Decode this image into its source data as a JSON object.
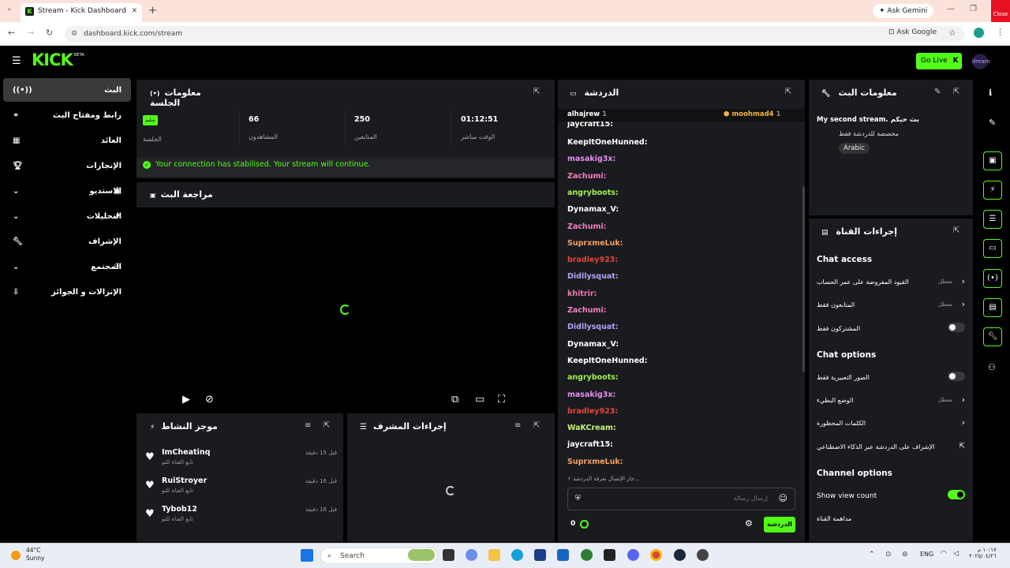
{
  "browser": {
    "tab_title": "Stream - Kick Dashboard",
    "url": "dashboard.kick.com/stream",
    "ask_gemini": "Ask Gemini",
    "ask_google": "Ask Google",
    "close_tooltip": "Close"
  },
  "header": {
    "logo": "KICK",
    "beta": "BETA",
    "go_live": "Go Live",
    "avatar_text": "dream"
  },
  "sidebar": {
    "items": [
      {
        "label": "البث"
      },
      {
        "label": "رابط ومفتاح البث"
      },
      {
        "label": "العائد"
      },
      {
        "label": "الإنجازات"
      },
      {
        "label": "الاستديو"
      },
      {
        "label": "التحليلات"
      },
      {
        "label": "الإشراف"
      },
      {
        "label": "المجتمع"
      },
      {
        "label": "الإنزالات و الجوائز"
      }
    ]
  },
  "session": {
    "title": "معلومات الجلسة",
    "badge": "سليم",
    "badge_label": "الجلسة",
    "stats": [
      {
        "value": "66",
        "label": "المشاهدون"
      },
      {
        "value": "250",
        "label": "المتابعين"
      },
      {
        "value": "01:12:51",
        "label": "الوقت مباشر"
      }
    ],
    "banner": "Your connection has stabilised. Your stream will continue."
  },
  "review": {
    "title": "مراجعة البث"
  },
  "activity": {
    "title": "موجز النشاط",
    "items": [
      {
        "name": "ImCheatinq",
        "sub": "تابع القناة للتو",
        "time": "قبل 15 دقيقة"
      },
      {
        "name": "RuiStroyer",
        "sub": "تابع القناة للتو",
        "time": "قبل 16 دقيقة"
      },
      {
        "name": "Tybob12",
        "sub": "تابع القناة للتو",
        "time": "قبل 16 دقيقة"
      }
    ]
  },
  "mod_actions": {
    "title": "إجراءات المشرف"
  },
  "chat": {
    "title": "الدردشة",
    "pinned_left": "alhajrew",
    "pinned_left_count": "1",
    "pinned_right": "moohmad4",
    "pinned_right_count": "1",
    "messages": [
      {
        "user": "jaycraft15:",
        "color": "#ffffff"
      },
      {
        "user": "KeepItOneHunned:",
        "color": "#ffffff"
      },
      {
        "user": "masakig3x:",
        "color": "#e88ef0"
      },
      {
        "user": "Zachumi:",
        "color": "#f580c0"
      },
      {
        "user": "angryboots:",
        "color": "#a3f050"
      },
      {
        "user": "Dynamax_V:",
        "color": "#ffffff"
      },
      {
        "user": "Zachumi:",
        "color": "#f580c0"
      },
      {
        "user": "SuprxmeLuk:",
        "color": "#f7a060"
      },
      {
        "user": "bradley923:",
        "color": "#e2443c"
      },
      {
        "user": "Didllysquat:",
        "color": "#b0a4f5"
      },
      {
        "user": "khitrir:",
        "color": "#f07ab0"
      },
      {
        "user": "Zachumi:",
        "color": "#f580c0"
      },
      {
        "user": "Didllysquat:",
        "color": "#b0a4f5"
      },
      {
        "user": "Dynamax_V:",
        "color": "#ffffff"
      },
      {
        "user": "KeepItOneHunned:",
        "color": "#ffffff"
      },
      {
        "user": "angryboots:",
        "color": "#a3f050"
      },
      {
        "user": "masakig3x:",
        "color": "#e88ef0"
      },
      {
        "user": "bradley923:",
        "color": "#e2443c"
      },
      {
        "user": "WaKCream:",
        "color": "#c8f07a"
      },
      {
        "user": "jaycraft15:",
        "color": "#ffffff"
      },
      {
        "user": "SuprxmeLuk:",
        "color": "#f7a060"
      }
    ],
    "connecting": "جار الإتصال بغرفة الدردشة...",
    "input_placeholder": "إرسال رسالة",
    "count": "0",
    "send_button": "الدردشة"
  },
  "stream_info": {
    "title": "معلومات البث",
    "stream_title": "My second stream. بث حيكم",
    "category": "مخصصة للدردشة فقط",
    "language": "Arabic"
  },
  "channel_actions": {
    "title": "إجراءات القناة",
    "chat_access": "Chat access",
    "access_items": [
      {
        "label": "القيود المفروضة على عمر الحساب",
        "value": "معطل"
      },
      {
        "label": "المتابعون فقط",
        "value": "معطل"
      },
      {
        "label": "المشتركون فقط"
      }
    ],
    "chat_options": "Chat options",
    "option_items": [
      {
        "label": "الصور التعبيرية فقط"
      },
      {
        "label": "الوضع البطيء",
        "value": "معطل"
      },
      {
        "label": "الكلمات المحظورة"
      },
      {
        "label": "الإشراف على الدردشة عبر الذكاء الاصطناعي"
      }
    ],
    "channel_options": "Channel options",
    "show_view_count": "Show view count",
    "raid": "مداهمة القناة"
  },
  "taskbar": {
    "temp": "44°C",
    "weather": "Sunny",
    "search": "Search",
    "lang": "ENG",
    "time": "١٠:١٧ م",
    "date": "٢٠٢٥/٠٤/٢٦"
  }
}
